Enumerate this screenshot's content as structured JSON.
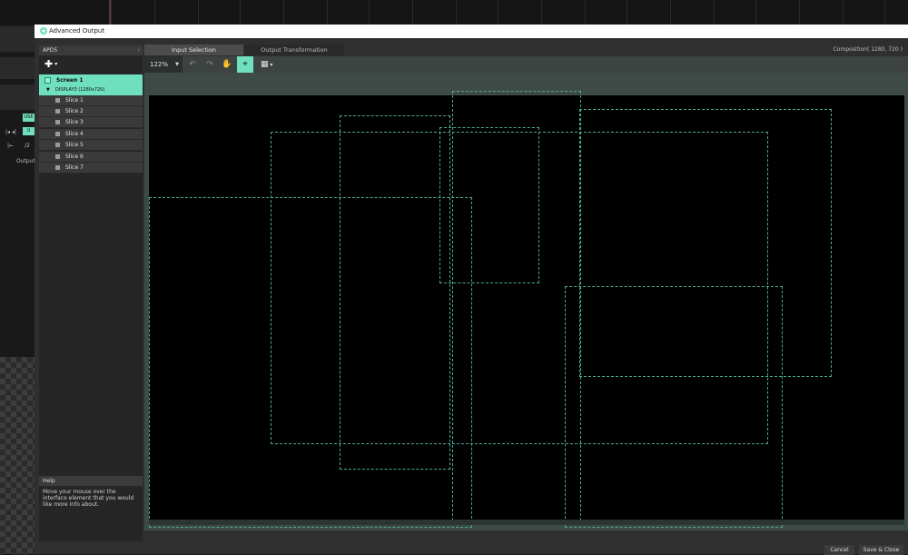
{
  "background_app": {
    "left_tag": "USE",
    "left_button": "U",
    "transport_a": "|◂ ◂|",
    "transport_b": "|←",
    "transport_c": "/2",
    "output_label": "Output"
  },
  "window": {
    "title": "Advanced Output",
    "logo_icon": "resolume-logo-icon"
  },
  "left_panel": {
    "device_select": "APD5",
    "add_button_icon": "plus-icon",
    "screen": {
      "name": "Screen 1",
      "display": "DISPLAY3 (1280x720)"
    },
    "slices": [
      {
        "label": "Slice 1"
      },
      {
        "label": "Slice 2"
      },
      {
        "label": "Slice 3"
      },
      {
        "label": "Slice 4"
      },
      {
        "label": "Slice 5"
      },
      {
        "label": "Slice 6"
      },
      {
        "label": "Slice 7"
      }
    ],
    "help": {
      "title": "Help",
      "text": "Move your mouse over the interface element that you would like more info about."
    }
  },
  "tabs": [
    {
      "label": "Input Selection",
      "active": true
    },
    {
      "label": "Output Transformation",
      "active": false
    }
  ],
  "composition_label": "Composition( 1280, 720 )",
  "toolbar": {
    "zoom": "122%",
    "tools": [
      {
        "name": "undo-icon",
        "glyph": "↶"
      },
      {
        "name": "redo-icon",
        "glyph": "↷"
      },
      {
        "name": "hand-icon",
        "glyph": "✋"
      },
      {
        "name": "magnet-icon",
        "glyph": "⌖",
        "active": true
      },
      {
        "name": "grid-icon",
        "glyph": "▦"
      }
    ]
  },
  "footer": {
    "cancel": "Cancel",
    "save_close": "Save & Close"
  },
  "colors": {
    "accent": "#6fe0bd",
    "slice_outline": "#4ca896",
    "stage": "#000000"
  }
}
